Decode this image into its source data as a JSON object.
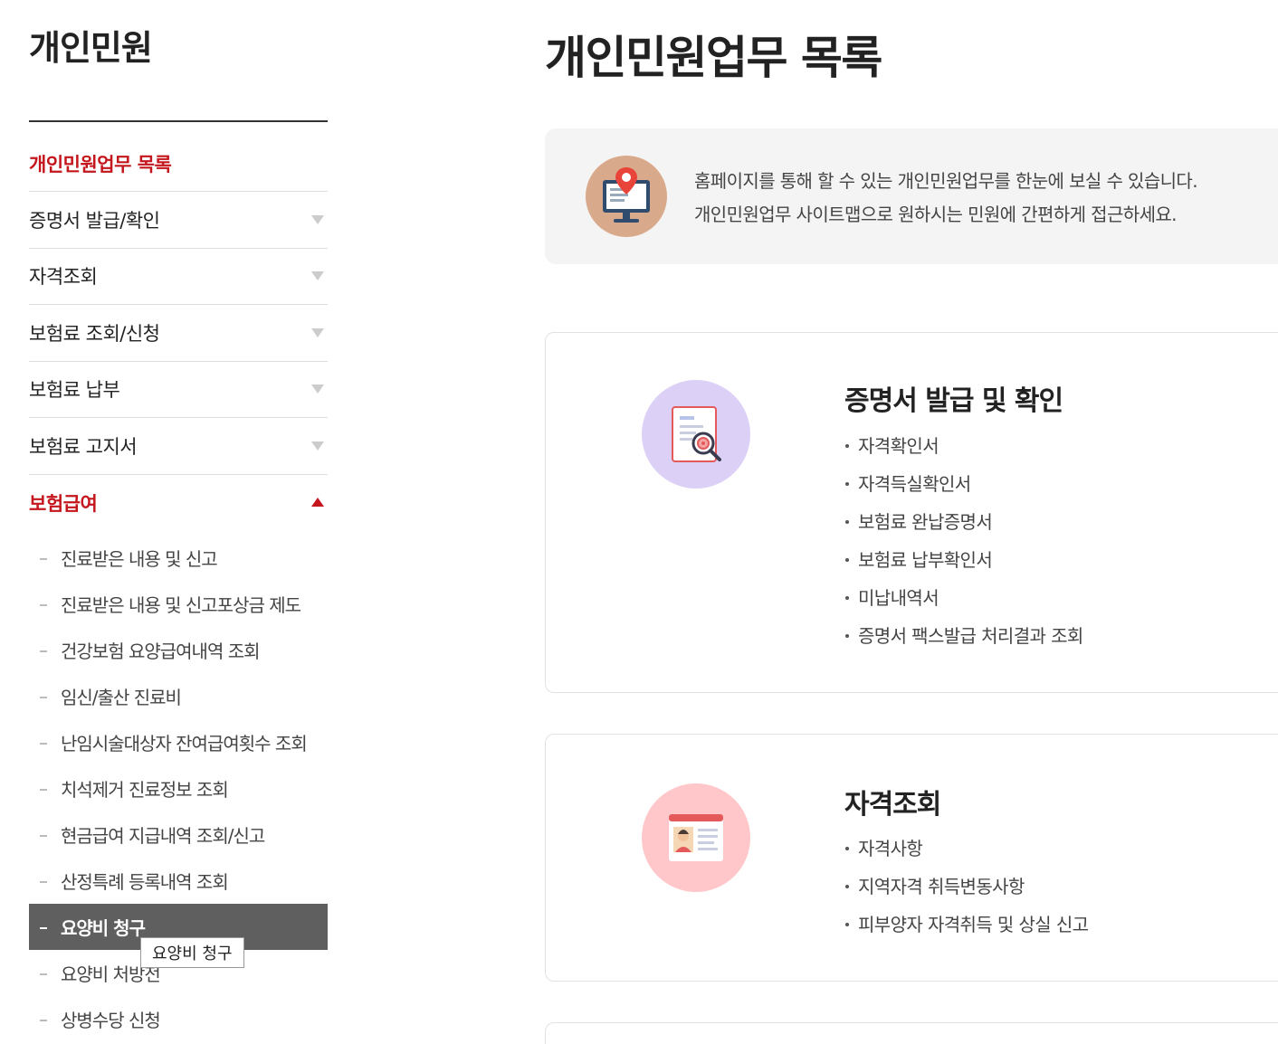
{
  "sidebar": {
    "title": "개인민원",
    "menu": [
      {
        "label": "개인민원업무 목록"
      },
      {
        "label": "증명서 발급/확인"
      },
      {
        "label": "자격조회"
      },
      {
        "label": "보험료 조회/신청"
      },
      {
        "label": "보험료 납부"
      },
      {
        "label": "보험료 고지서"
      },
      {
        "label": "보험급여"
      }
    ],
    "submenu": [
      {
        "label": "진료받은 내용 및 신고"
      },
      {
        "label": "진료받은 내용 및 신고포상금 제도"
      },
      {
        "label": "건강보험 요양급여내역 조회"
      },
      {
        "label": "임신/출산 진료비"
      },
      {
        "label": "난임시술대상자 잔여급여횟수 조회"
      },
      {
        "label": "치석제거 진료정보 조회"
      },
      {
        "label": "현금급여 지급내역 조회/신고"
      },
      {
        "label": "산정특례 등록내역 조회"
      },
      {
        "label": "요양비 청구"
      },
      {
        "label": "요양비 처방전"
      },
      {
        "label": "상병수당 신청"
      }
    ],
    "tooltip": "요양비 청구"
  },
  "main": {
    "title": "개인민원업무 목록",
    "intro": {
      "line1": "홈페이지를 통해 할 수 있는 개인민원업무를 한눈에 보실 수 있습니다.",
      "line2": "개인민원업무 사이트맵으로 원하시는 민원에 간편하게 접근하세요."
    },
    "cards": [
      {
        "title": "증명서 발급 및 확인",
        "items": [
          "자격확인서",
          "자격득실확인서",
          "보험료 완납증명서",
          "보험료 납부확인서",
          "미납내역서",
          "증명서 팩스발급 처리결과 조회"
        ]
      },
      {
        "title": "자격조회",
        "items": [
          "자격사항",
          "지역자격 취득변동사항",
          "피부양자 자격취득 및 상실 신고"
        ]
      }
    ]
  },
  "colors": {
    "accent": "#c4161c",
    "current_bg": "#5f5f5f",
    "intro_bg": "#f4f4f4",
    "card1_icon_bg": "#ddd0f7",
    "card2_icon_bg": "#ffc7c9"
  },
  "icons": {
    "intro": "monitor-location-icon",
    "card1": "document-search-icon",
    "card2": "id-card-icon",
    "menu_collapsed": "triangle-down-icon",
    "menu_expanded": "triangle-up-icon"
  }
}
